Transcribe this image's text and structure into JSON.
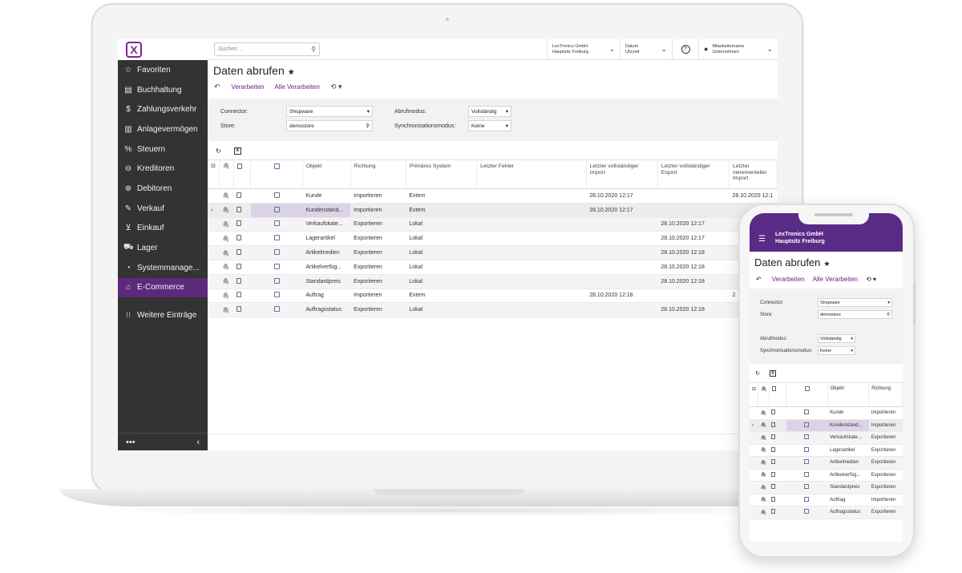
{
  "desktop": {
    "search_placeholder": "Suchen ...",
    "company": {
      "line1": "LexTronics GmbH",
      "line2": "Hauptsitz Freiburg"
    },
    "date": {
      "line1": "Datum",
      "line2": "Uhrzeit"
    },
    "user": {
      "line1": "Mitarbeitername",
      "line2": "Unternehmen"
    },
    "help_label": "?",
    "sidebar": {
      "items": [
        {
          "label": "Favoriten",
          "icon": "star-icon",
          "glyph": "☆"
        },
        {
          "label": "Buchhaltung",
          "icon": "ledger-icon",
          "glyph": "▤"
        },
        {
          "label": "Zahlungsverkehr",
          "icon": "dollar-icon",
          "glyph": "$"
        },
        {
          "label": "Anlagevermögen",
          "icon": "building-icon",
          "glyph": "▥"
        },
        {
          "label": "Steuern",
          "icon": "percent-icon",
          "glyph": "%"
        },
        {
          "label": "Kreditoren",
          "icon": "minus-circle-icon",
          "glyph": "⊖"
        },
        {
          "label": "Debitoren",
          "icon": "plus-circle-icon",
          "glyph": "⊕"
        },
        {
          "label": "Verkauf",
          "icon": "edit-icon",
          "glyph": "✎"
        },
        {
          "label": "Einkauf",
          "icon": "cart-icon",
          "glyph": "⊻"
        },
        {
          "label": "Lager",
          "icon": "truck-icon",
          "glyph": "⛟"
        },
        {
          "label": "Systemmanage...",
          "icon": "pie-icon",
          "glyph": "◔"
        },
        {
          "label": "E-Commerce",
          "icon": "basket-icon",
          "glyph": "⌂"
        }
      ],
      "more": {
        "label": "Weitere Einträge",
        "icon": "grid-icon",
        "glyph": "⁝⁝"
      },
      "bottom_more": "•••",
      "bottom_collapse": "‹"
    },
    "page_title": "Daten abrufen",
    "toolbar": {
      "process": "Verarbeiten",
      "process_all": "Alle Verarbeiten"
    },
    "filters": {
      "connector_label": "Connector:",
      "connector_value": "Shopware",
      "store_label": "Store:",
      "store_value": "demostore",
      "fetch_mode_label": "Abrufmodus:",
      "fetch_mode_value": "Vollständig",
      "sync_mode_label": "Synchronisationsmodus:",
      "sync_mode_value": "Keine"
    },
    "columns": [
      "Objekt",
      "Richtung",
      "Primäres System",
      "Letzter Fehler",
      "Letzter vollständiger Import",
      "Letzter vollständiger Export",
      "Letzter inkrementeller Import"
    ],
    "rows": [
      {
        "objekt": "Kunde",
        "richtung": "Importieren",
        "system": "Extern",
        "fehler": "",
        "import": "28.10.2020 12:17",
        "export": "",
        "inkr": "28.10.2020 12:1"
      },
      {
        "objekt": "Kundenstand...",
        "richtung": "Importieren",
        "system": "Extern",
        "fehler": "",
        "import": "28.10.2020 12:17",
        "export": "",
        "inkr": ""
      },
      {
        "objekt": "Verkaufskate...",
        "richtung": "Exportieren",
        "system": "Lokal",
        "fehler": "",
        "import": "",
        "export": "28.10.2020 12:17",
        "inkr": ""
      },
      {
        "objekt": "Lagerartikel",
        "richtung": "Exportieren",
        "system": "Lokal",
        "fehler": "",
        "import": "",
        "export": "28.10.2020 12:17",
        "inkr": ""
      },
      {
        "objekt": "Artikelmedien",
        "richtung": "Exportieren",
        "system": "Lokal",
        "fehler": "",
        "import": "",
        "export": "28.10.2020 12:18",
        "inkr": ""
      },
      {
        "objekt": "Artikelverfüg...",
        "richtung": "Exportieren",
        "system": "Lokal",
        "fehler": "",
        "import": "",
        "export": "28.10.2020 12:18",
        "inkr": ""
      },
      {
        "objekt": "Standardpreis",
        "richtung": "Exportieren",
        "system": "Lokal",
        "fehler": "",
        "import": "",
        "export": "28.10.2020 12:18",
        "inkr": ""
      },
      {
        "objekt": "Auftrag",
        "richtung": "Importieren",
        "system": "Extern",
        "fehler": "",
        "import": "28.10.2020 12:18",
        "export": "",
        "inkr": "2"
      },
      {
        "objekt": "Auftragsstatus",
        "richtung": "Exportieren",
        "system": "Lokal",
        "fehler": "",
        "import": "",
        "export": "28.10.2020 12:18",
        "inkr": ""
      }
    ]
  },
  "mobile": {
    "company": {
      "line1": "LexTronics GmbH",
      "line2": "Hauptsitz Freiburg"
    },
    "page_title": "Daten abrufen",
    "toolbar": {
      "process": "Verarbeiten",
      "process_all": "Alle Verarbeiten"
    },
    "filters": {
      "connector_label": "Connector:",
      "connector_value": "Shopware",
      "store_label": "Store:",
      "store_value": "demostore",
      "fetch_mode_label": "Abrufmodus:",
      "fetch_mode_value": "Vollständig",
      "sync_mode_label": "Synchronisationsmodus:",
      "sync_mode_value": "Keine"
    },
    "columns": [
      "Objekt",
      "Richtung"
    ],
    "rows": [
      {
        "objekt": "Kunde",
        "richtung": "Importieren"
      },
      {
        "objekt": "Kundenstand...",
        "richtung": "Importieren"
      },
      {
        "objekt": "Verkaufskate...",
        "richtung": "Exportieren"
      },
      {
        "objekt": "Lagerartikel",
        "richtung": "Exportieren"
      },
      {
        "objekt": "Artikelmedien",
        "richtung": "Exportieren"
      },
      {
        "objekt": "Artikelverfüg...",
        "richtung": "Exportieren"
      },
      {
        "objekt": "Standardpreis",
        "richtung": "Exportieren"
      },
      {
        "objekt": "Auftrag",
        "richtung": "Importieren"
      },
      {
        "objekt": "Auftragsstatus",
        "richtung": "Exportieren"
      }
    ]
  },
  "colors": {
    "accent": "#5c2a7a",
    "link": "#6b1e7e",
    "sidebar": "#333334",
    "selected_cell": "#dcd3e6"
  }
}
